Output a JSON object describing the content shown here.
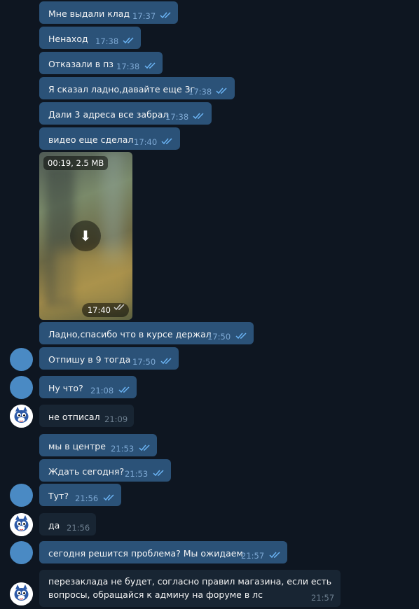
{
  "colors": {
    "background": "#0e1621",
    "outgoing_bubble": "#2b5278",
    "incoming_bubble": "#182533",
    "read_check": "#6ab3f3"
  },
  "messages": [
    {
      "text": "Мне выдали клад",
      "time": "17:37"
    },
    {
      "text": "Ненаход",
      "time": "17:38"
    },
    {
      "text": "Отказали в пз",
      "time": "17:38"
    },
    {
      "text": "Я сказал ладно,давайте еще 3г",
      "time": "17:38"
    },
    {
      "text": "Дали 3 адреса все забрал",
      "time": "17:38"
    },
    {
      "text": "видео еще сделал",
      "time": "17:40"
    },
    {
      "text": "Ладно,спасибо что в курсе держал",
      "time": "17:50"
    },
    {
      "text": "Отпишу в 9 тогда",
      "time": "17:50"
    },
    {
      "text": "Ну что?",
      "time": "21:08"
    },
    {
      "text": "не отписал",
      "time": "21:09"
    },
    {
      "text": "мы в центре",
      "time": "21:53"
    },
    {
      "text": "Ждать сегодня?",
      "time": "21:53"
    },
    {
      "text": "Тут?",
      "time": "21:56"
    },
    {
      "text": "да",
      "time": "21:56"
    },
    {
      "text": "сегодня решится проблема? Мы ожидаем",
      "time": "21:57"
    },
    {
      "line1": "перезаклада не будет, согласно правил магазина, если есть",
      "line2": "вопросы, обращайся к админу на форуме в лс",
      "time": "21:57"
    }
  ],
  "video": {
    "info": "00:19, 2.5 MB",
    "time": "17:40",
    "icon": "download-arrow-icon"
  }
}
